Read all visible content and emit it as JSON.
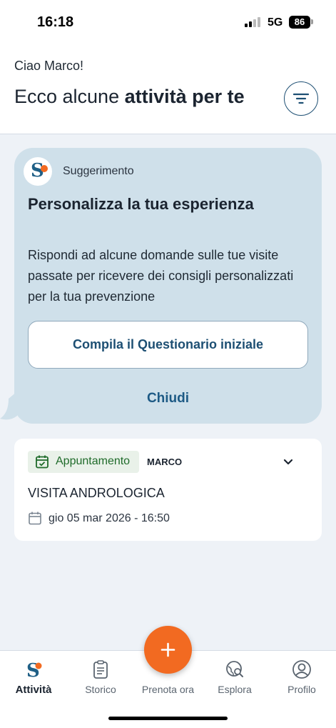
{
  "status_bar": {
    "time": "16:18",
    "network": "5G",
    "battery": "86"
  },
  "header": {
    "greeting": "Ciao Marco!",
    "headline_prefix": "Ecco alcune ",
    "headline_bold": "attività per te",
    "filter_icon": "filter-icon"
  },
  "suggestion": {
    "label": "Suggerimento",
    "title": "Personalizza la tua esperienza",
    "text": "Rispondi ad alcune domande sulle tue visite passate per ricevere dei consigli personalizzati per la tua prevenzione",
    "cta_label": "Compila il Questionario iniziale",
    "close_label": "Chiudi"
  },
  "appointment": {
    "badge": "Appuntamento",
    "owner": "MARCO",
    "title": "VISITA ANDROLOGICA",
    "datetime": "gio 05 mar 2026 - 16:50"
  },
  "nav": {
    "items": [
      {
        "label": "Attività",
        "icon": "activity-logo-icon",
        "active": true
      },
      {
        "label": "Storico",
        "icon": "clipboard-icon",
        "active": false
      },
      {
        "label": "Esplora",
        "icon": "globe-search-icon",
        "active": false
      },
      {
        "label": "Profilo",
        "icon": "user-circle-icon",
        "active": false
      }
    ],
    "fab_label": "Prenota ora"
  },
  "colors": {
    "accent_orange": "#f26a21",
    "primary_blue": "#1d4f73",
    "card_blue": "#cfe0ea",
    "badge_green": "#1f6b2a"
  }
}
